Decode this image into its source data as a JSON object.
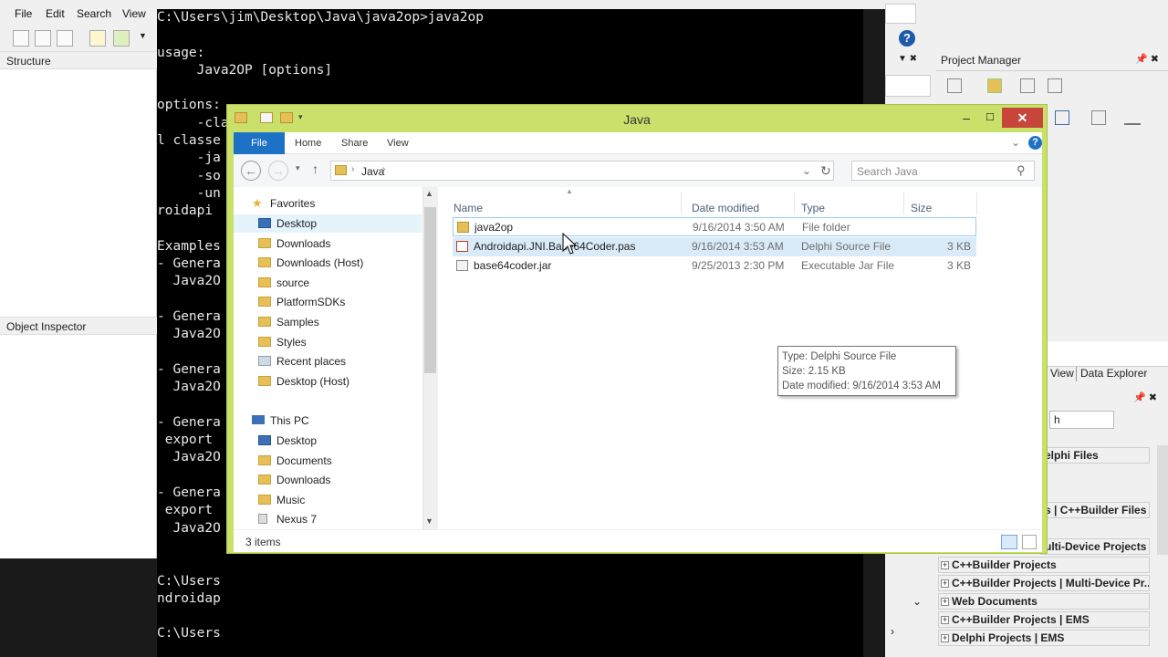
{
  "ide": {
    "menu": [
      "File",
      "Edit",
      "Search",
      "View"
    ],
    "structure_title": "Structure",
    "object_inspector_title": "Object Inspector",
    "project_manager_title": "Project Manager",
    "right_tabs": [
      "View",
      "Data Explorer"
    ],
    "search_fragment": "h",
    "tree_items": [
      "elphi Files",
      "s | C++Builder Files",
      "ulti-Device Projects",
      "C++Builder Projects",
      "C++Builder Projects | Multi-Device Pr...",
      "Web Documents",
      "C++Builder Projects | EMS",
      "Delphi Projects | EMS"
    ]
  },
  "console": {
    "lines": [
      "C:\\Users\\jim\\Desktop\\Java\\java2op>java2op",
      "",
      "usage:",
      "     Java2OP [options]",
      "",
      "options:",
      "     -classes classes : list of class names or packages to export, default is al",
      "l classe",
      "     -ja",
      "     -so",
      "     -un",
      "roidapi",
      "",
      "Examples",
      "- Genera",
      "  Java2O",
      "",
      "- Genera",
      "  Java2O",
      "",
      "- Genera",
      "  Java2O",
      "",
      "- Genera",
      " export",
      "  Java2O",
      "",
      "- Genera",
      " export",
      "  Java2O",
      "",
      "",
      "C:\\Users",
      "ndroidap",
      "",
      "C:\\Users"
    ]
  },
  "explorer": {
    "title": "Java",
    "ribbon_tabs": [
      "File",
      "Home",
      "Share",
      "View"
    ],
    "address": "Java",
    "search_placeholder": "Search Java",
    "favorites_label": "Favorites",
    "favorites": [
      "Desktop",
      "Downloads",
      "Downloads (Host)",
      "source",
      "PlatformSDKs",
      "Samples",
      "Styles",
      "Recent places",
      "Desktop (Host)"
    ],
    "thispc_label": "This PC",
    "thispc": [
      "Desktop",
      "Documents",
      "Downloads",
      "Music",
      "Nexus 7"
    ],
    "columns": [
      "Name",
      "Date modified",
      "Type",
      "Size"
    ],
    "files": [
      {
        "name": "java2op",
        "date": "9/16/2014 3:50 AM",
        "type": "File folder",
        "size": ""
      },
      {
        "name": "Androidapi.JNI.Base64Coder.pas",
        "date": "9/16/2014 3:53 AM",
        "type": "Delphi Source File",
        "size": "3 KB"
      },
      {
        "name": "base64coder.jar",
        "date": "9/25/2013 2:30 PM",
        "type": "Executable Jar File",
        "size": "3 KB"
      }
    ],
    "tooltip": {
      "type": "Type: Delphi Source File",
      "size": "Size: 2.15 KB",
      "modified": "Date modified: 9/16/2014 3:53 AM"
    },
    "status": "3 items",
    "colors": {
      "title_bar": "#c9e06a",
      "file_tab": "#1e72c6",
      "close_button": "#c7453a",
      "selection": "#cce8ff"
    }
  }
}
